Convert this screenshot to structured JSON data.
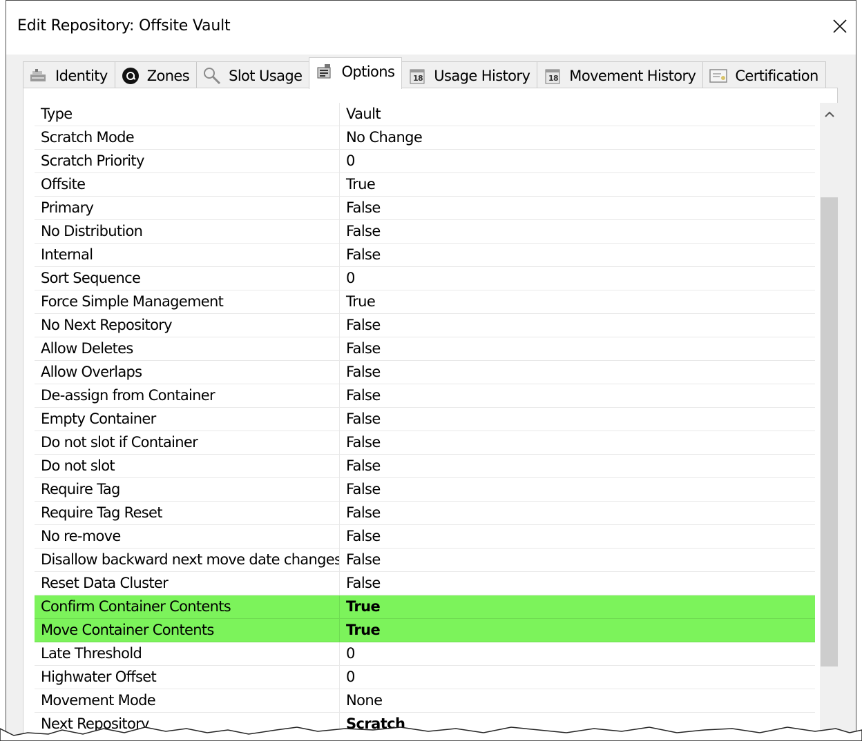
{
  "window": {
    "title": "Edit Repository: Offsite Vault"
  },
  "tabs": [
    {
      "label": "Identity",
      "icon": "identity-icon"
    },
    {
      "label": "Zones",
      "icon": "zones-icon"
    },
    {
      "label": "Slot Usage",
      "icon": "magnifier-icon"
    },
    {
      "label": "Options",
      "icon": "options-icon",
      "active": true
    },
    {
      "label": "Usage History",
      "icon": "calendar-icon"
    },
    {
      "label": "Movement History",
      "icon": "calendar-icon"
    },
    {
      "label": "Certification",
      "icon": "certificate-icon"
    }
  ],
  "properties": [
    {
      "name": "Type",
      "value": "Vault"
    },
    {
      "name": "Scratch Mode",
      "value": "No Change"
    },
    {
      "name": "Scratch Priority",
      "value": "0"
    },
    {
      "name": "Offsite",
      "value": "True"
    },
    {
      "name": "Primary",
      "value": "False"
    },
    {
      "name": "No Distribution",
      "value": "False"
    },
    {
      "name": "Internal",
      "value": "False"
    },
    {
      "name": "Sort Sequence",
      "value": "0"
    },
    {
      "name": "Force Simple Management",
      "value": "True"
    },
    {
      "name": "No Next Repository",
      "value": "False"
    },
    {
      "name": "Allow Deletes",
      "value": "False"
    },
    {
      "name": "Allow Overlaps",
      "value": "False"
    },
    {
      "name": "De-assign from Container",
      "value": "False"
    },
    {
      "name": "Empty Container",
      "value": "False"
    },
    {
      "name": "Do not slot if Container",
      "value": "False"
    },
    {
      "name": "Do not slot",
      "value": "False"
    },
    {
      "name": "Require Tag",
      "value": "False"
    },
    {
      "name": "Require Tag Reset",
      "value": "False"
    },
    {
      "name": "No re-move",
      "value": "False"
    },
    {
      "name": "Disallow backward next move date changes",
      "value": "False"
    },
    {
      "name": "Reset Data Cluster",
      "value": "False"
    },
    {
      "name": "Confirm Container Contents",
      "value": "True"
    },
    {
      "name": "Move Container Contents",
      "value": "True"
    },
    {
      "name": "Late Threshold",
      "value": "0"
    },
    {
      "name": "Highwater Offset",
      "value": "0"
    },
    {
      "name": "Movement Mode",
      "value": "None"
    },
    {
      "name": "Next Repository",
      "value": "Scratch"
    }
  ],
  "colors": {
    "highlight": "#7cf35b"
  }
}
